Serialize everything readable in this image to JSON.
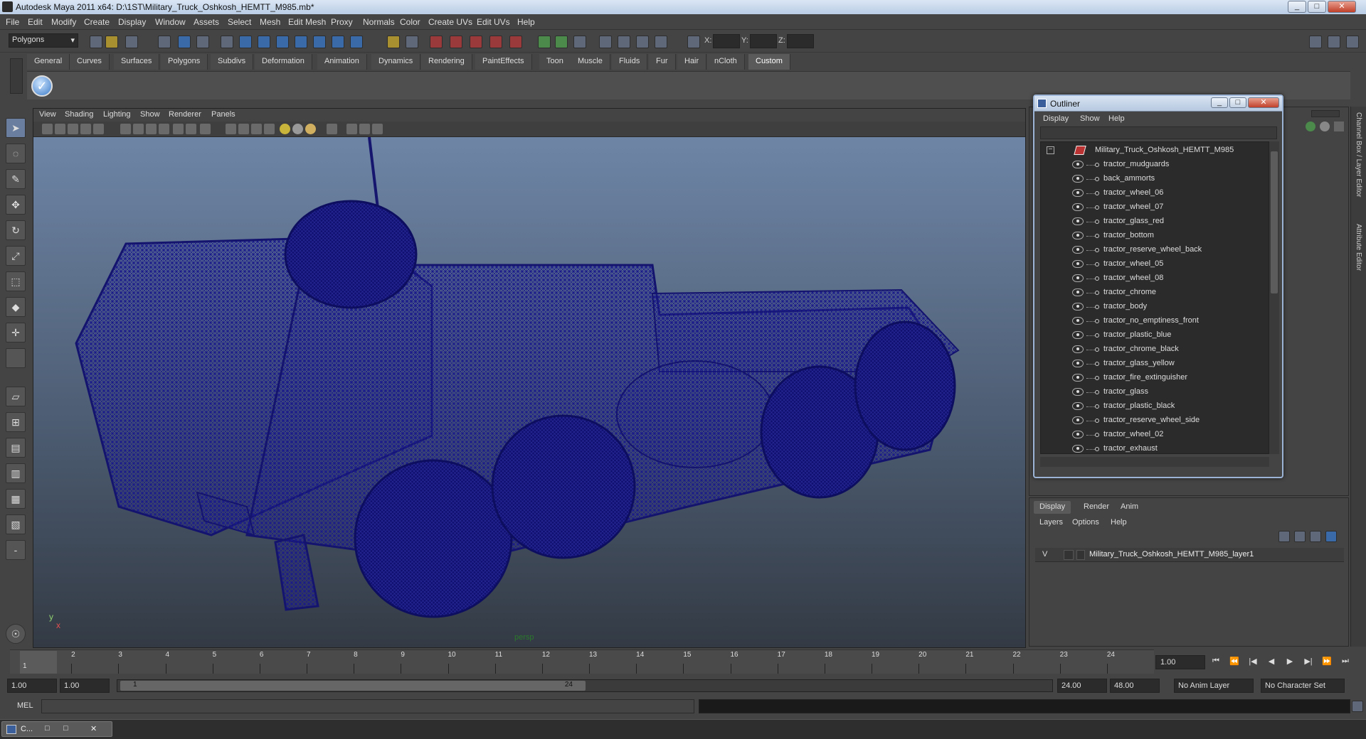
{
  "window": {
    "title": "Autodesk Maya 2011 x64: D:\\1ST\\Military_Truck_Oshkosh_HEMTT_M985.mb*",
    "minimize": "_",
    "maximize": "□",
    "close": "✕"
  },
  "menu": [
    "File",
    "Edit",
    "Modify",
    "Create",
    "Display",
    "Window",
    "Assets",
    "Select",
    "Mesh",
    "Edit Mesh",
    "Proxy",
    "Normals",
    "Color",
    "Create UVs",
    "Edit UVs",
    "Help"
  ],
  "toolbar": {
    "mode": "Polygons",
    "x_label": "X:",
    "y_label": "Y:",
    "z_label": "Z:"
  },
  "shelf": {
    "tabs": [
      "General",
      "Curves",
      "Surfaces",
      "Polygons",
      "Subdivs",
      "Deformation",
      "Animation",
      "Dynamics",
      "Rendering",
      "PaintEffects",
      "Toon",
      "Muscle",
      "Fluids",
      "Fur",
      "Hair",
      "nCloth",
      "Custom"
    ],
    "active": "Custom"
  },
  "viewport": {
    "menu": [
      "View",
      "Shading",
      "Lighting",
      "Show",
      "Renderer",
      "Panels"
    ],
    "camera": "persp",
    "axis_y": "y",
    "axis_x": "x",
    "wire_color": "#15157a"
  },
  "outliner": {
    "title": "Outliner",
    "menu": [
      "Display",
      "Show",
      "Help"
    ],
    "root": "Military_Truck_Oshkosh_HEMTT_M985",
    "items": [
      "tractor_mudguards",
      "back_ammorts",
      "tractor_wheel_06",
      "tractor_wheel_07",
      "tractor_glass_red",
      "tractor_bottom",
      "tractor_reserve_wheel_back",
      "tractor_wheel_05",
      "tractor_wheel_08",
      "tractor_chrome",
      "tractor_body",
      "tractor_no_emptiness_front",
      "tractor_plastic_blue",
      "tractor_chrome_black",
      "tractor_glass_yellow",
      "tractor_fire_extinguisher",
      "tractor_glass",
      "tractor_plastic_black",
      "tractor_reserve_wheel_side",
      "tractor_wheel_02",
      "tractor_exhaust"
    ]
  },
  "side_labels": {
    "channel_box": "Channel Box / Layer Editor",
    "attribute_editor": "Attribute Editor"
  },
  "layer_editor": {
    "tabs": [
      "Display",
      "Render",
      "Anim"
    ],
    "active": "Display",
    "menu": [
      "Layers",
      "Options",
      "Help"
    ],
    "layer": {
      "visible": "V",
      "name": "Military_Truck_Oshkosh_HEMTT_M985_layer1"
    }
  },
  "timeline": {
    "ticks": [
      "1",
      "2",
      "3",
      "4",
      "5",
      "6",
      "7",
      "8",
      "9",
      "10",
      "11",
      "12",
      "13",
      "14",
      "15",
      "16",
      "17",
      "18",
      "19",
      "20",
      "21",
      "22",
      "23",
      "24"
    ],
    "current_marker": "1",
    "current_frame": "1.00"
  },
  "range": {
    "start_time": "1.00",
    "playback_start": "1.00",
    "handle_start": "1",
    "handle_end": "24",
    "playback_end": "24.00",
    "end_time": "48.00",
    "anim_layer": "No Anim Layer",
    "character_set": "No Character Set"
  },
  "command": {
    "label": "MEL"
  },
  "taskbar": {
    "item": "C..."
  }
}
